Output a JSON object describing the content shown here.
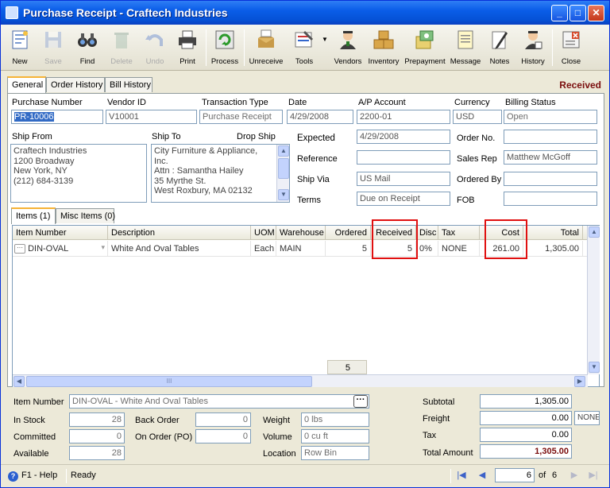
{
  "window": {
    "title": "Purchase Receipt - Craftech Industries",
    "minimize": "_",
    "maximize": "□",
    "close": "✕"
  },
  "toolbar": {
    "new": "New",
    "save": "Save",
    "find": "Find",
    "delete": "Delete",
    "undo": "Undo",
    "print": "Print",
    "process": "Process",
    "unreceive": "Unreceive",
    "tools": "Tools",
    "vendors": "Vendors",
    "inventory": "Inventory",
    "prepayment": "Prepayment",
    "message": "Message",
    "notes": "Notes",
    "history": "History",
    "close": "Close"
  },
  "tabs": {
    "general": "General",
    "order_history": "Order History",
    "bill_history": "Bill History"
  },
  "status": "Received",
  "header": {
    "purchase_number_label": "Purchase Number",
    "purchase_number": "PR-10006",
    "vendor_id_label": "Vendor ID",
    "vendor_id": "V10001",
    "transaction_type_label": "Transaction Type",
    "transaction_type": "Purchase Receipt",
    "date_label": "Date",
    "date": "4/29/2008",
    "ap_account_label": "A/P Account",
    "ap_account": "2200-01",
    "currency_label": "Currency",
    "currency": "USD",
    "billing_status_label": "Billing Status",
    "billing_status": "Open"
  },
  "ship": {
    "ship_from_label": "Ship From",
    "ship_from": "Craftech Industries\n1200 Broadway\nNew York, NY\n(212) 684-3139",
    "ship_to_label": "Ship To",
    "drop_ship_label": "Drop Ship",
    "ship_to": "City Furniture & Appliance,\nInc.\nAttn : Samantha Hailey\n35 Myrthe St.\nWest Roxbury, MA 02132"
  },
  "details": {
    "expected_label": "Expected",
    "expected": "4/29/2008",
    "reference_label": "Reference",
    "reference": "",
    "ship_via_label": "Ship Via",
    "ship_via": "US Mail",
    "terms_label": "Terms",
    "terms": "Due on Receipt",
    "order_no_label": "Order No.",
    "order_no": "",
    "sales_rep_label": "Sales Rep",
    "sales_rep": "Matthew McGoff",
    "ordered_by_label": "Ordered By",
    "ordered_by": "",
    "fob_label": "FOB",
    "fob": ""
  },
  "subtabs": {
    "items": "Items (1)",
    "misc_items": "Misc Items (0)"
  },
  "grid": {
    "columns": {
      "item_number": "Item Number",
      "description": "Description",
      "uom": "UOM",
      "warehouse": "Warehouse",
      "ordered": "Ordered",
      "received": "Received",
      "disc": "Disc",
      "tax": "Tax",
      "cost": "Cost",
      "total": "Total"
    },
    "rows": [
      {
        "item_number": "DIN-OVAL",
        "description": "White And Oval Tables",
        "uom": "Each",
        "warehouse": "MAIN",
        "ordered": "5",
        "received": "5",
        "disc": "0%",
        "tax": "NONE",
        "cost": "261.00",
        "total": "1,305.00"
      }
    ],
    "received_total": "5",
    "scroll_grip": "III"
  },
  "item_info": {
    "item_number_label": "Item Number",
    "item_number": "DIN-OVAL - White And Oval Tables",
    "in_stock_label": "In Stock",
    "in_stock": "28",
    "committed_label": "Committed",
    "committed": "0",
    "available_label": "Available",
    "available": "28",
    "back_order_label": "Back Order",
    "back_order": "0",
    "on_order_label": "On Order (PO)",
    "on_order": "0",
    "weight_label": "Weight",
    "weight": "0 lbs",
    "volume_label": "Volume",
    "volume": "0 cu ft",
    "location_label": "Location",
    "location": "Row  Bin"
  },
  "totals": {
    "subtotal_label": "Subtotal",
    "subtotal": "1,305.00",
    "freight_label": "Freight",
    "freight": "0.00",
    "freight_tax": "NONE",
    "tax_label": "Tax",
    "tax": "0.00",
    "total_amount_label": "Total Amount",
    "total_amount": "1,305.00"
  },
  "statusbar": {
    "help": "F1 - Help",
    "state": "Ready",
    "record": "6",
    "of_label": "of",
    "total_records": "6"
  }
}
